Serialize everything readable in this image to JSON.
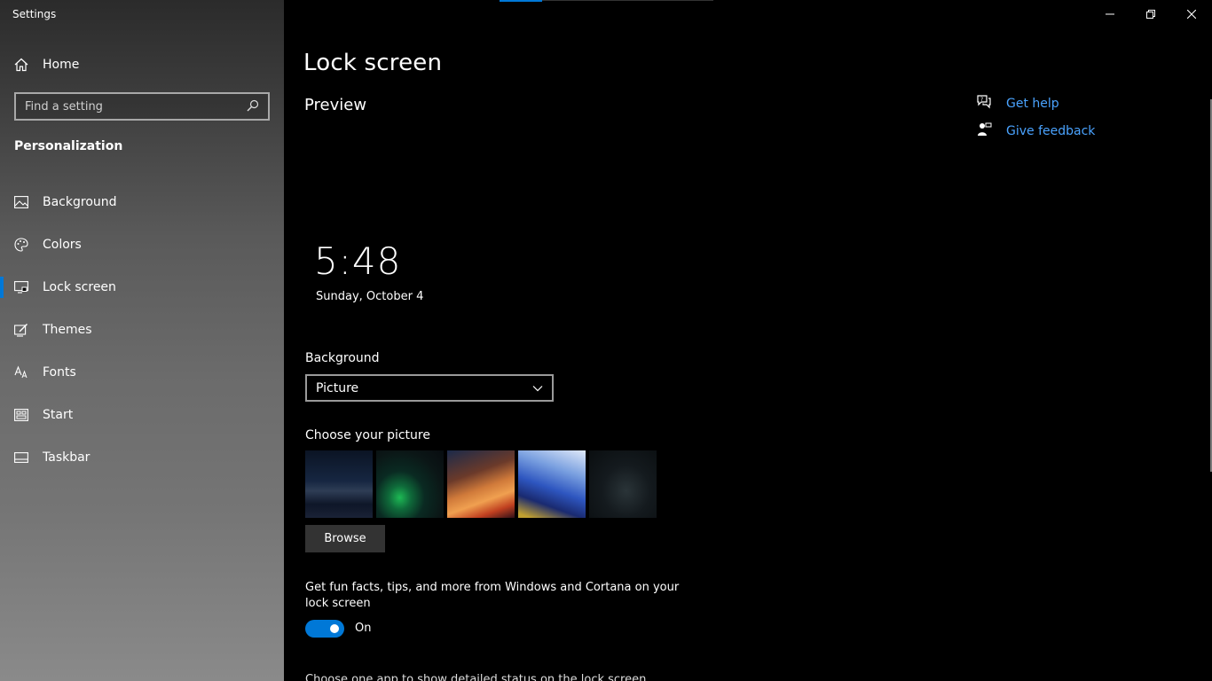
{
  "app": {
    "title": "Settings"
  },
  "sidebar": {
    "home_label": "Home",
    "search_placeholder": "Find a setting",
    "section_title": "Personalization",
    "items": [
      {
        "label": "Background",
        "icon": "picture-icon"
      },
      {
        "label": "Colors",
        "icon": "palette-icon"
      },
      {
        "label": "Lock screen",
        "icon": "lock-screen-icon",
        "selected": true
      },
      {
        "label": "Themes",
        "icon": "themes-icon"
      },
      {
        "label": "Fonts",
        "icon": "fonts-icon"
      },
      {
        "label": "Start",
        "icon": "start-icon"
      },
      {
        "label": "Taskbar",
        "icon": "taskbar-icon"
      }
    ]
  },
  "main": {
    "page_title": "Lock screen",
    "preview_title": "Preview",
    "clock_time": "5:48",
    "clock_date": "Sunday, October 4",
    "background_label": "Background",
    "background_value": "Picture",
    "choose_label": "Choose your picture",
    "browse_label": "Browse",
    "fun_facts_text": "Get fun facts, tips, and more from Windows and Cortana on your lock screen",
    "toggle_state": "On",
    "cutoff_text": "Choose one app to show detailed status on the lock screen"
  },
  "help": {
    "get_help": "Get help",
    "give_feedback": "Give feedback"
  },
  "colors": {
    "accent": "#0078d7",
    "link": "#4aa3ff"
  }
}
